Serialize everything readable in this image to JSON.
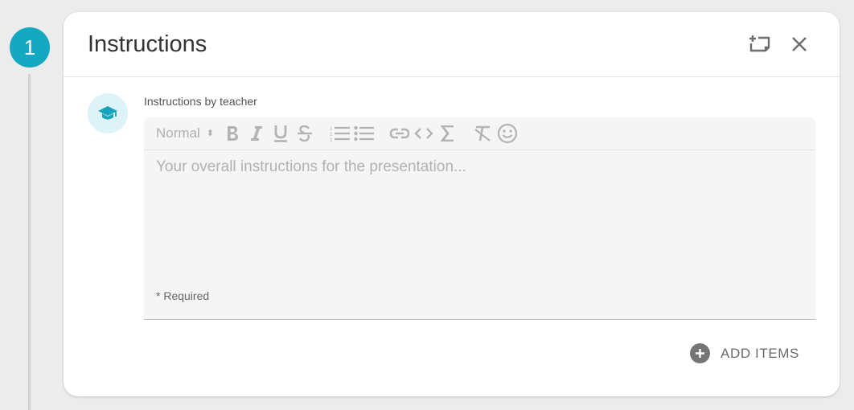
{
  "step": {
    "number": "1"
  },
  "card": {
    "title": "Instructions"
  },
  "editor": {
    "label": "Instructions by teacher",
    "format_value": "Normal",
    "placeholder": "Your overall instructions for the presentation...",
    "required_note": "* Required",
    "toolbar_icons": [
      "bold-icon",
      "italic-icon",
      "underline-icon",
      "strikethrough-icon",
      "ordered-list-icon",
      "bullet-list-icon",
      "link-icon",
      "code-icon",
      "formula-icon",
      "clear-format-icon",
      "emoji-icon"
    ]
  },
  "footer": {
    "add_items_label": "ADD ITEMS"
  },
  "colors": {
    "accent": "#15a9c1",
    "avatar_bg": "#ddf3f7",
    "page_bg": "#ececec"
  }
}
